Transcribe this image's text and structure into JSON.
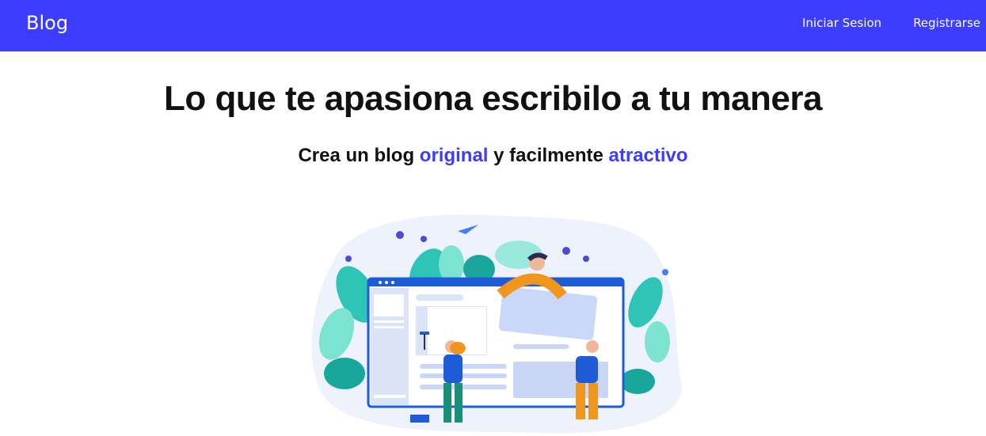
{
  "navbar": {
    "brand": "Blog",
    "links": [
      {
        "label": "Iniciar Sesion"
      },
      {
        "label": "Registrarse"
      }
    ],
    "color": "#3d3dff"
  },
  "hero": {
    "title": "Lo que te apasiona escribilo a tu manera",
    "subtitle": {
      "part1": "Crea un blog ",
      "accent1": "original",
      "part2": " y facilmente ",
      "accent2": "atractivo"
    },
    "accent_color": "#3d3dff"
  },
  "illustration": {
    "icon": "website-building-illustration"
  }
}
